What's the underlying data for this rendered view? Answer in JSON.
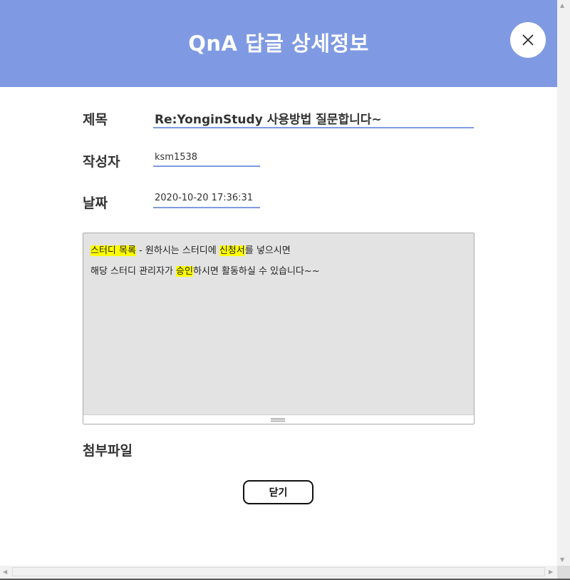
{
  "header": {
    "title": "QnA 답글 상세정보",
    "close_icon": "close-icon"
  },
  "fields": {
    "title_label": "제목",
    "title_value": "Re:YonginStudy 사용방법 질문합니다~",
    "author_label": "작성자",
    "author_value": "ksm1538",
    "date_label": "날짜",
    "date_value": "2020-10-20 17:36:31"
  },
  "content": {
    "line1": {
      "hl1": "스터디 목록",
      "t1": " - 원하시는 스터디에 ",
      "hl2": "신청서",
      "t2": "를 넣으시면"
    },
    "line2": {
      "t1": "해당 스터디 관리자가 ",
      "hl1": "승인",
      "t2": "하시면 활동하실 수 있습니다~~"
    },
    "resize_icon": "resize-grip-icon"
  },
  "attachment": {
    "label": "첨부파일"
  },
  "footer": {
    "close_label": "닫기"
  },
  "colors": {
    "header_bg": "#7f9ae2",
    "underline": "#7f9ae2",
    "highlight": "#ffff00",
    "content_bg": "#e3e3e3"
  }
}
